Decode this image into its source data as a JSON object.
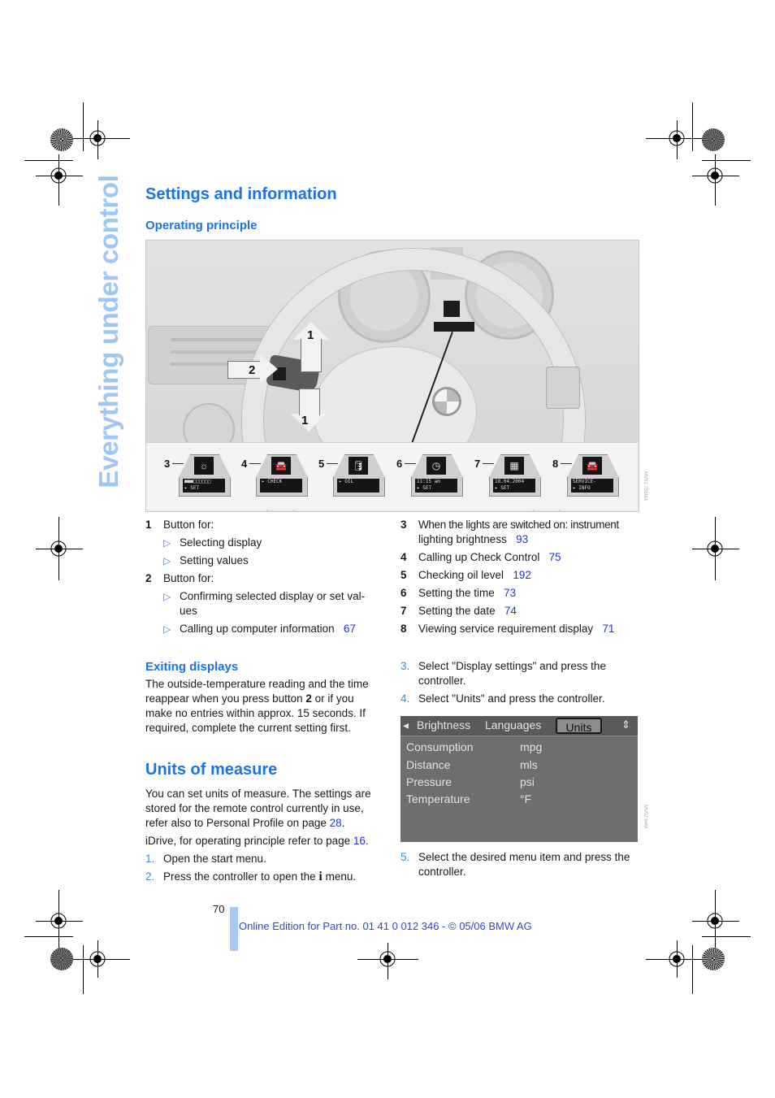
{
  "side_tab": {
    "label": "Everything under control"
  },
  "section": {
    "title": "Settings and information",
    "subtitle": "Operating principle"
  },
  "illustration": {
    "callouts": [
      "1",
      "2",
      "1"
    ],
    "displays": [
      {
        "num": "3",
        "icon": "brightness-icon",
        "glyph": "☼",
        "line1": "■■■□□□□□□",
        "line2": "▸ SET"
      },
      {
        "num": "4",
        "icon": "car-icon",
        "glyph": "🚘",
        "line1": "",
        "line2": "▸ CHECK"
      },
      {
        "num": "5",
        "icon": "oil-can-icon",
        "glyph": "🛢",
        "line1": "",
        "line2": "▸   OIL"
      },
      {
        "num": "6",
        "icon": "clock-icon",
        "glyph": "◷",
        "line1": "11:15 am",
        "line2": "▸ SET"
      },
      {
        "num": "7",
        "icon": "calendar-icon",
        "glyph": "▦",
        "line1": "18.04.2004",
        "line2": "▸ SET"
      },
      {
        "num": "8",
        "icon": "car-service-icon",
        "glyph": "🚘",
        "line1": "SERVICE-",
        "line2": "▸ INFO"
      }
    ]
  },
  "legend_left": [
    {
      "num": "1",
      "text": "Button for:",
      "subs": [
        {
          "text": "Selecting display",
          "page": ""
        },
        {
          "text": "Setting values",
          "page": ""
        }
      ]
    },
    {
      "num": "2",
      "text": "Button for:",
      "subs": [
        {
          "text": "Confirming selected display or set val-",
          "text2": "ues",
          "page": ""
        },
        {
          "text": "Calling up computer information",
          "page": "67"
        }
      ]
    }
  ],
  "legend_right": [
    {
      "num": "3",
      "text": "When the lights are switched on: instrument",
      "text2": "lighting brightness",
      "page": "93"
    },
    {
      "num": "4",
      "text": "Calling up Check Control",
      "page": "75"
    },
    {
      "num": "5",
      "text": "Checking oil level",
      "page": "192"
    },
    {
      "num": "6",
      "text": "Setting the time",
      "page": "73"
    },
    {
      "num": "7",
      "text": "Setting the date",
      "page": "74"
    },
    {
      "num": "8",
      "text": "Viewing service requirement display",
      "page": "71"
    }
  ],
  "exiting": {
    "title": "Exiting displays",
    "p1": "The outside-temperature reading and the time",
    "p2a": "reappear when you press button ",
    "p2b": "2",
    "p2c": " or if you",
    "p3": "make no entries within approx. 15 seconds. If",
    "p4": "required, complete the current setting first."
  },
  "units": {
    "title": "Units of measure",
    "p1": "You can set units of measure. The settings are",
    "p2": "stored for the remote control currently in use,",
    "p3a": "refer also to Personal Profile on page ",
    "p3_page": "28",
    "p3b": ".",
    "p4a": "iDrive, for operating principle refer to page ",
    "p4_page": "16",
    "p4b": ".",
    "steps": [
      {
        "n": "1.",
        "text": "Open the start menu."
      },
      {
        "n": "2.",
        "text": "Press the controller to open the",
        "icon": "i",
        "text_after": " menu."
      },
      {
        "n": "3.",
        "text": "Select \"Display settings\" and press the",
        "text2": "controller."
      },
      {
        "n": "4.",
        "text": "Select \"Units\" and press the controller."
      },
      {
        "n": "5.",
        "text": "Select the desired menu item and press the",
        "text2": "controller."
      }
    ]
  },
  "idrive_screen": {
    "tabs": [
      "Brightness",
      "Languages",
      "Units"
    ],
    "active_tab": "Units",
    "rows": [
      {
        "label": "Consumption",
        "value": "mpg"
      },
      {
        "label": "Distance",
        "value": "mls"
      },
      {
        "label": "Pressure",
        "value": "psi"
      },
      {
        "label": "Temperature",
        "value": "°F"
      }
    ]
  },
  "footer": {
    "page_number": "70",
    "edition": "Online Edition for Part no. 01 41 0 012 346 - © 05/06 BMW AG"
  },
  "colors": {
    "heading": "#1a73e8",
    "sidetab": "#9fc6f5",
    "link": "#2233dd",
    "footer_bar": "#a8c9f4"
  }
}
